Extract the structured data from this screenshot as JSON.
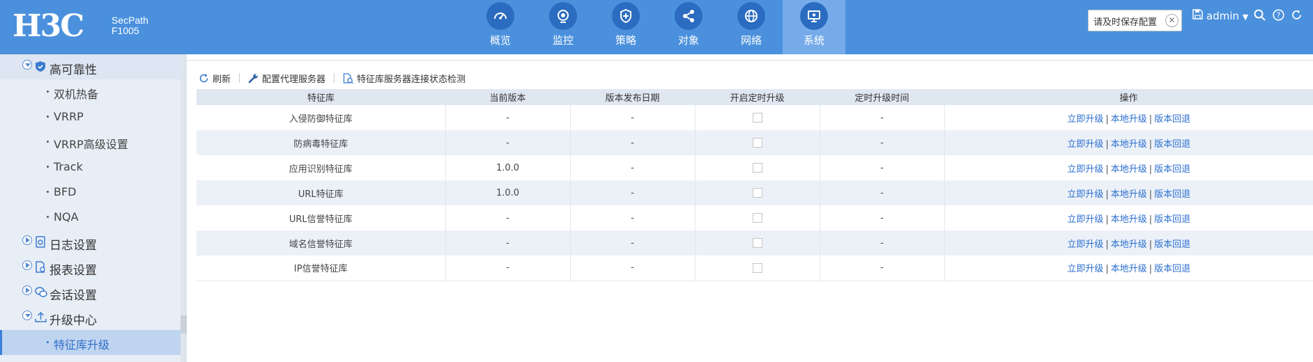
{
  "header": {
    "logo": "H3C",
    "product_line1": "SecPath",
    "product_line2": "F1005",
    "nav": [
      {
        "label": "概览",
        "icon": "dashboard-icon",
        "active": false
      },
      {
        "label": "监控",
        "icon": "monitor-icon",
        "active": false
      },
      {
        "label": "策略",
        "icon": "shield-icon",
        "active": false
      },
      {
        "label": "对象",
        "icon": "share-icon",
        "active": false
      },
      {
        "label": "网络",
        "icon": "globe-icon",
        "active": false
      },
      {
        "label": "系统",
        "icon": "system-icon",
        "active": true
      }
    ],
    "notice": "请及时保存配置",
    "user": "admin",
    "accent": "#4a90dd"
  },
  "sidebar": {
    "items": [
      {
        "label": "高可靠性",
        "level": 1,
        "icon": "shield-icon",
        "expanded": true
      },
      {
        "label": "双机热备",
        "level": 2
      },
      {
        "label": "VRRP",
        "level": 2
      },
      {
        "label": "VRRP高级设置",
        "level": 2
      },
      {
        "label": "Track",
        "level": 2
      },
      {
        "label": "BFD",
        "level": 2
      },
      {
        "label": "NQA",
        "level": 2
      },
      {
        "label": "日志设置",
        "level": 1,
        "icon": "log-icon",
        "expanded": false
      },
      {
        "label": "报表设置",
        "level": 1,
        "icon": "report-icon",
        "expanded": false
      },
      {
        "label": "会话设置",
        "level": 1,
        "icon": "session-icon",
        "expanded": false
      },
      {
        "label": "升级中心",
        "level": 1,
        "icon": "upload-icon",
        "expanded": true
      },
      {
        "label": "特征库升级",
        "level": 2,
        "selected": true
      }
    ]
  },
  "toolbar": {
    "refresh": "刷新",
    "proxy": "配置代理服务器",
    "check": "特征库服务器连接状态检测"
  },
  "table": {
    "columns": [
      "特征库",
      "当前版本",
      "版本发布日期",
      "开启定时升级",
      "定时升级时间",
      "操作"
    ],
    "rows": [
      {
        "name": "入侵防御特征库",
        "version": "-",
        "date": "-",
        "scheduled": false,
        "time": "-"
      },
      {
        "name": "防病毒特征库",
        "version": "-",
        "date": "-",
        "scheduled": false,
        "time": "-"
      },
      {
        "name": "应用识别特征库",
        "version": "1.0.0",
        "date": "-",
        "scheduled": false,
        "time": "-"
      },
      {
        "name": "URL特征库",
        "version": "1.0.0",
        "date": "-",
        "scheduled": false,
        "time": "-"
      },
      {
        "name": "URL信誉特征库",
        "version": "-",
        "date": "-",
        "scheduled": false,
        "time": "-"
      },
      {
        "name": "域名信誉特征库",
        "version": "-",
        "date": "-",
        "scheduled": false,
        "time": "-"
      },
      {
        "name": "IP信誉特征库",
        "version": "-",
        "date": "-",
        "scheduled": false,
        "time": "-"
      }
    ],
    "actions": [
      "立即升级",
      "本地升级",
      "版本回退"
    ],
    "action_separator": "|"
  }
}
